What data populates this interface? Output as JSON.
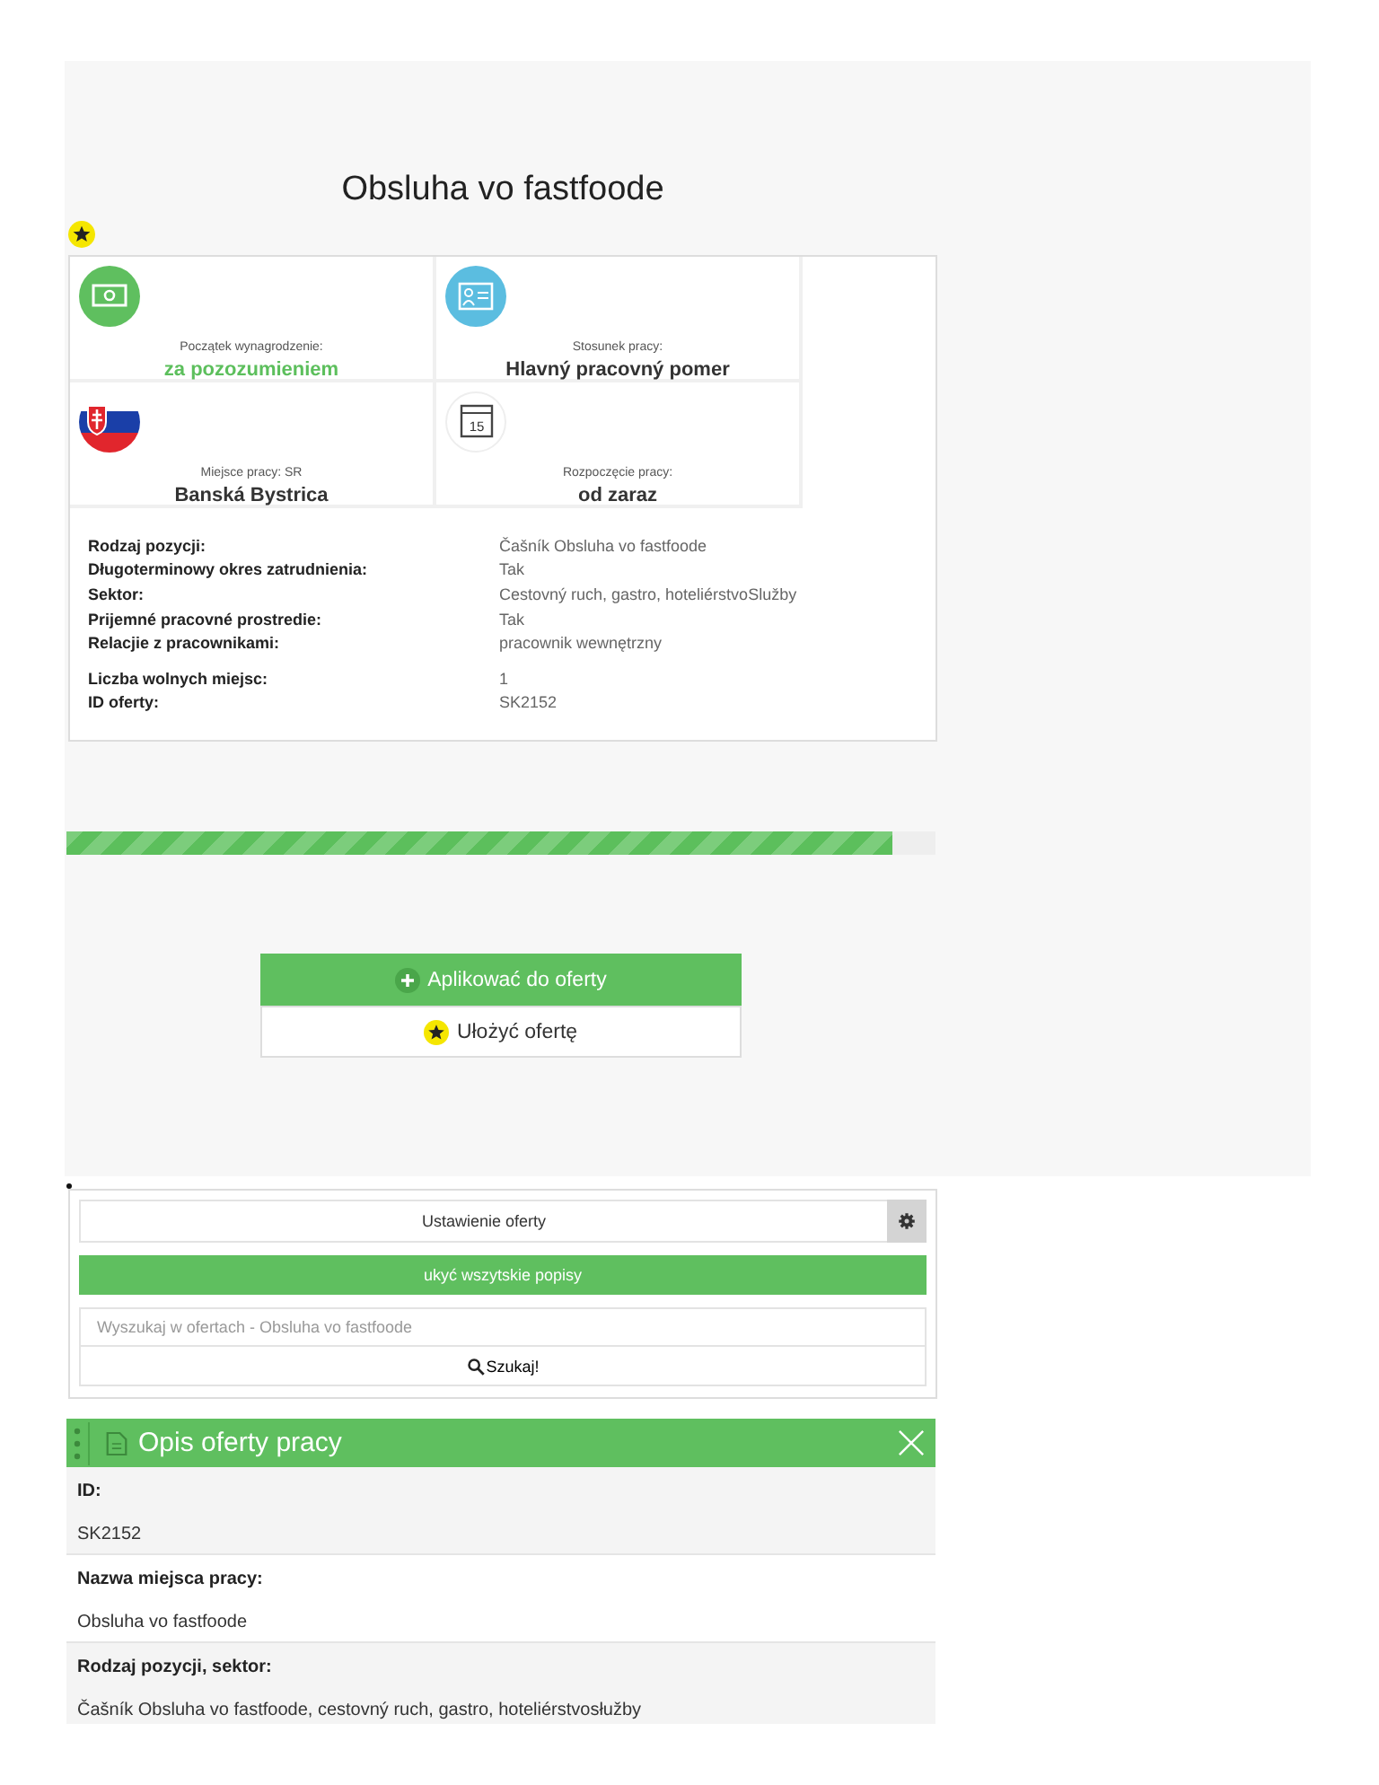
{
  "title": "Obsluha vo fastfoode",
  "favorite": {
    "on": true
  },
  "tiles": [
    {
      "kind": "money",
      "label": "Początek wynagrodzenie:",
      "value": "za pozozumieniem",
      "highlight": true
    },
    {
      "kind": "badge",
      "label": "Stosunek pracy:",
      "value": "Hlavný pracovný pomer",
      "highlight": false
    },
    {
      "kind": "flag",
      "label": "Miejsce pracy: SR",
      "value": "Banská Bystrica",
      "highlight": false
    },
    {
      "kind": "calendar",
      "label": "Rozpoczęcie pracy:",
      "value": "od zaraz",
      "highlight": false,
      "icon_text": "15"
    }
  ],
  "details": [
    [
      {
        "label": "Rodzaj pozycji:",
        "value": "Čašník Obsluha vo fastfoode"
      },
      {
        "label": "Długoterminowy okres zatrudnienia:",
        "value": "Tak"
      },
      {
        "label": "Sektor:",
        "value": "Cestovný ruch, gastro, hoteliérstvoSlužby"
      },
      {
        "label": "Prijemné pracovné prostredie:",
        "value": "Tak"
      },
      {
        "label": "Relacjie z pracownikami:",
        "value": "pracownik wewnętrzny"
      }
    ],
    [
      {
        "label": "Liczba wolnych miejsc:",
        "value": "1"
      },
      {
        "label": "ID oferty:",
        "value": "SK2152"
      }
    ]
  ],
  "progress": {
    "level": 0.95
  },
  "apply_button": "Aplikować do oferty",
  "save_button": "Ułożyć ofertę",
  "settings": {
    "label": "Ustawienie oferty",
    "toggle_button": "ukyć wszytskie popisy",
    "search": {
      "placeholder": "Wyszukaj w ofertach - Obsluha vo fastfoode"
    },
    "search_button": "Szukaj!"
  },
  "description": {
    "title": "Opis oferty pracy",
    "rows": [
      {
        "label": "ID:",
        "value": "SK2152"
      },
      {
        "label": "Nazwa miejsca pracy:",
        "value": "Obsluha vo fastfoode"
      },
      {
        "label": "Rodzaj pozycji, sektor:",
        "value": "Čašník Obsluha vo fastfoode, cestovný ruch, gastro, hoteliérstvosłužby"
      }
    ]
  }
}
